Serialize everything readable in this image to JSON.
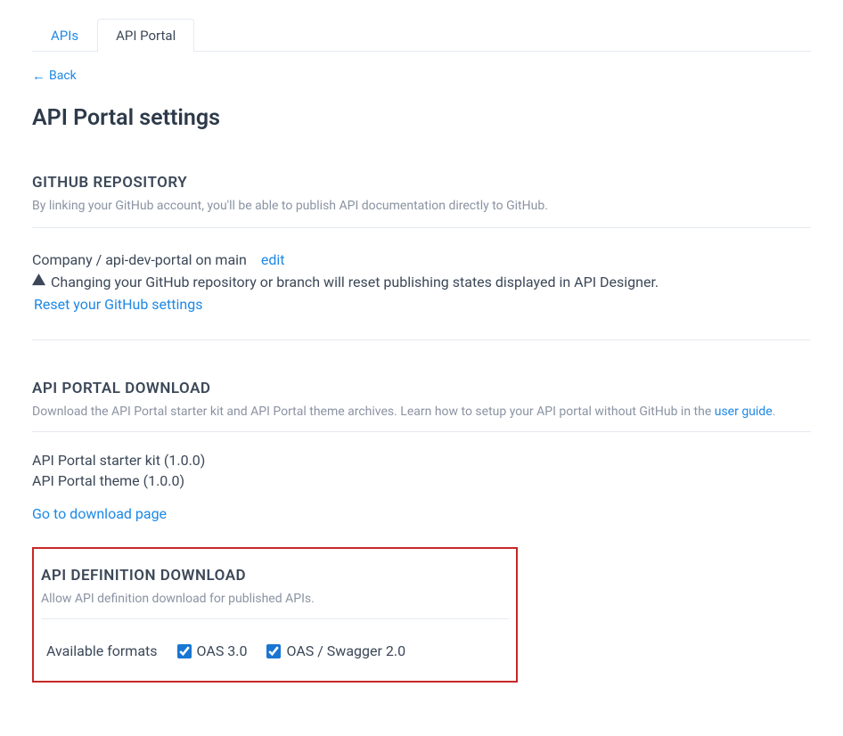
{
  "tabs": {
    "apis": "APIs",
    "portal": "API Portal"
  },
  "back": "Back",
  "page_title": "API Portal settings",
  "github": {
    "header": "GITHUB REPOSITORY",
    "desc": "By linking your GitHub account, you'll be able to publish API documentation directly to GitHub.",
    "repo_text": "Company / api-dev-portal on main",
    "edit_label": "edit",
    "warning_text": "Changing your GitHub repository or branch will reset publishing states displayed in API Designer.",
    "reset_label": "Reset your GitHub settings"
  },
  "download": {
    "header": "API PORTAL DOWNLOAD",
    "desc_prefix": "Download the API Portal starter kit and API Portal theme archives. Learn how to setup your API portal without GitHub in the ",
    "desc_link": "user guide",
    "desc_suffix": ".",
    "items": [
      "API Portal starter kit (1.0.0)",
      "API Portal theme (1.0.0)"
    ],
    "goto_label": "Go to download page"
  },
  "definition": {
    "header": "API DEFINITION DOWNLOAD",
    "desc": "Allow API definition download for published APIs.",
    "formats_label": "Available formats",
    "format1": "OAS 3.0",
    "format2": "OAS / Swagger 2.0"
  }
}
